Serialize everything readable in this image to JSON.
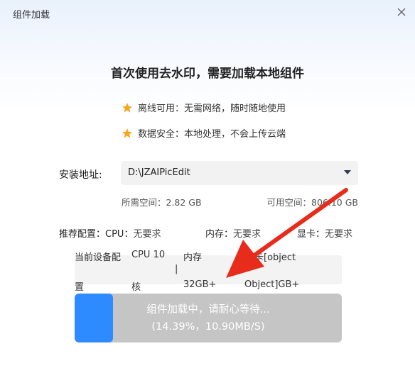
{
  "window": {
    "title": "组件加载"
  },
  "headline": "首次使用去水印，需要加载本地组件",
  "features": [
    {
      "icon": "star-icon",
      "text": "离线可用：无需网络，随时随地使用",
      "color": "#f5a623"
    },
    {
      "icon": "star-icon",
      "text": "数据安全：本地处理，不会上传云端",
      "color": "#f5a623"
    }
  ],
  "install": {
    "label": "安装地址:",
    "path": "D:\\JZAIPicEdit",
    "required_space": "所需空间：2.82 GB",
    "available_space": "可用空间：806.10 GB"
  },
  "recommend": {
    "label": "推荐配置：",
    "cpu_key": "CPU：",
    "cpu_value": "无要求",
    "mem_key": "内存：",
    "mem_value": "无要求",
    "gpu_key": "显卡：",
    "gpu_value": "无要求"
  },
  "current_device": {
    "label_line1": "当前设备配",
    "label_line2": "置",
    "cpu_line1": "CPU 10",
    "cpu_line2": "核",
    "mem_line1": "内存",
    "mem_sep": "|",
    "mem_line2": "32GB+",
    "gpu_line1": "显卡[object",
    "gpu_line2": "Object]GB+"
  },
  "progress": {
    "status": "组件加载中，请耐心等待...",
    "detail": "(14.39%，10.90MB/S)",
    "fraction": 0.1439,
    "fill_color": "#2e8bff",
    "track_color": "#c5c5c5"
  },
  "annotation": {
    "arrow_color": "#e82c1c"
  }
}
